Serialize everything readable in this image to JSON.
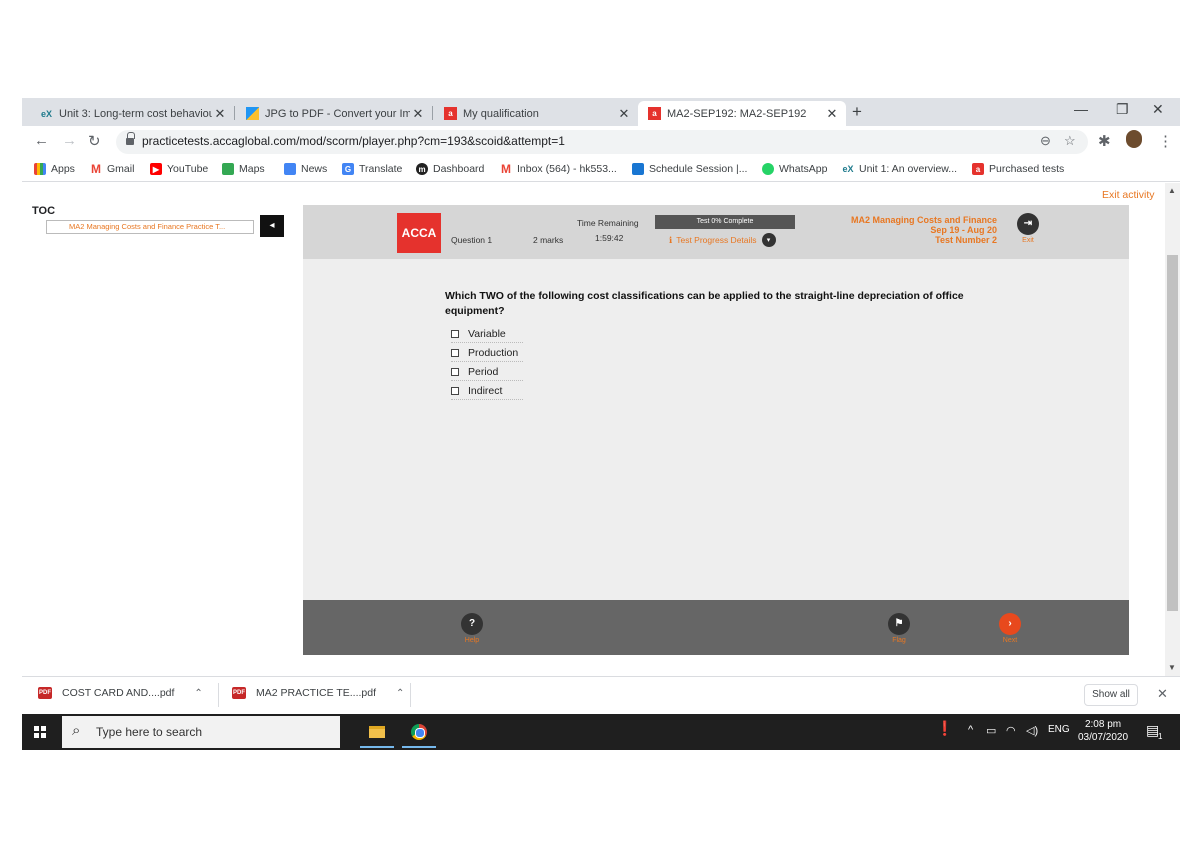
{
  "tabs": [
    {
      "title": "Unit 3: Long-term cost behaviour",
      "icon": "ex"
    },
    {
      "title": "JPG to PDF - Convert your Image",
      "icon": "jpg2pdf"
    },
    {
      "title": "My qualification",
      "icon": "acca"
    },
    {
      "title": "MA2-SEP192: MA2-SEP192",
      "icon": "acca"
    }
  ],
  "address": {
    "url": "practicetests.accaglobal.com/mod/scorm/player.php?cm=193&scoid&attempt=1"
  },
  "bookmarks": [
    {
      "label": "Apps"
    },
    {
      "label": "Gmail"
    },
    {
      "label": "YouTube"
    },
    {
      "label": "Maps"
    },
    {
      "label": "News"
    },
    {
      "label": "Translate"
    },
    {
      "label": "Dashboard"
    },
    {
      "label": "Inbox (564) - hk553..."
    },
    {
      "label": "Schedule Session |..."
    },
    {
      "label": "WhatsApp"
    },
    {
      "label": "Unit 1: An overview..."
    },
    {
      "label": "Purchased tests"
    }
  ],
  "page": {
    "exit_label": "Exit activity",
    "toc_label": "TOC",
    "toc_item": "MA2 Managing Costs and Finance Practice T..."
  },
  "scorm": {
    "brand": "ACCA",
    "question_label": "Question 1",
    "marks_label": "2 marks",
    "time_label": "Time Remaining",
    "time_value": "1:59:42",
    "progress_label": "Test 0% Complete",
    "progress_details": "Test Progress Details",
    "course_title": "MA2 Managing Costs and Finance",
    "course_dates": "Sep 19 - Aug 20",
    "test_number": "Test Number 2",
    "exit_label": "Exit",
    "question_text": "Which TWO of the following cost classifications can be applied to the straight-line depreciation of office equipment?",
    "options": [
      "Variable",
      "Production",
      "Period",
      "Indirect"
    ],
    "help_label": "Help",
    "flag_label": "Flag",
    "next_label": "Next"
  },
  "downloads": [
    {
      "name": "COST CARD AND....pdf"
    },
    {
      "name": "MA2 PRACTICE TE....pdf"
    }
  ],
  "downloads_show_all": "Show all",
  "taskbar": {
    "search_placeholder": "Type here to search",
    "lang": "ENG",
    "time": "2:08 pm",
    "date": "03/07/2020",
    "notifications": "1"
  },
  "colors": {
    "accent": "#e87722",
    "acca_red": "#e5322d",
    "taskbar": "#1f1f1f"
  }
}
